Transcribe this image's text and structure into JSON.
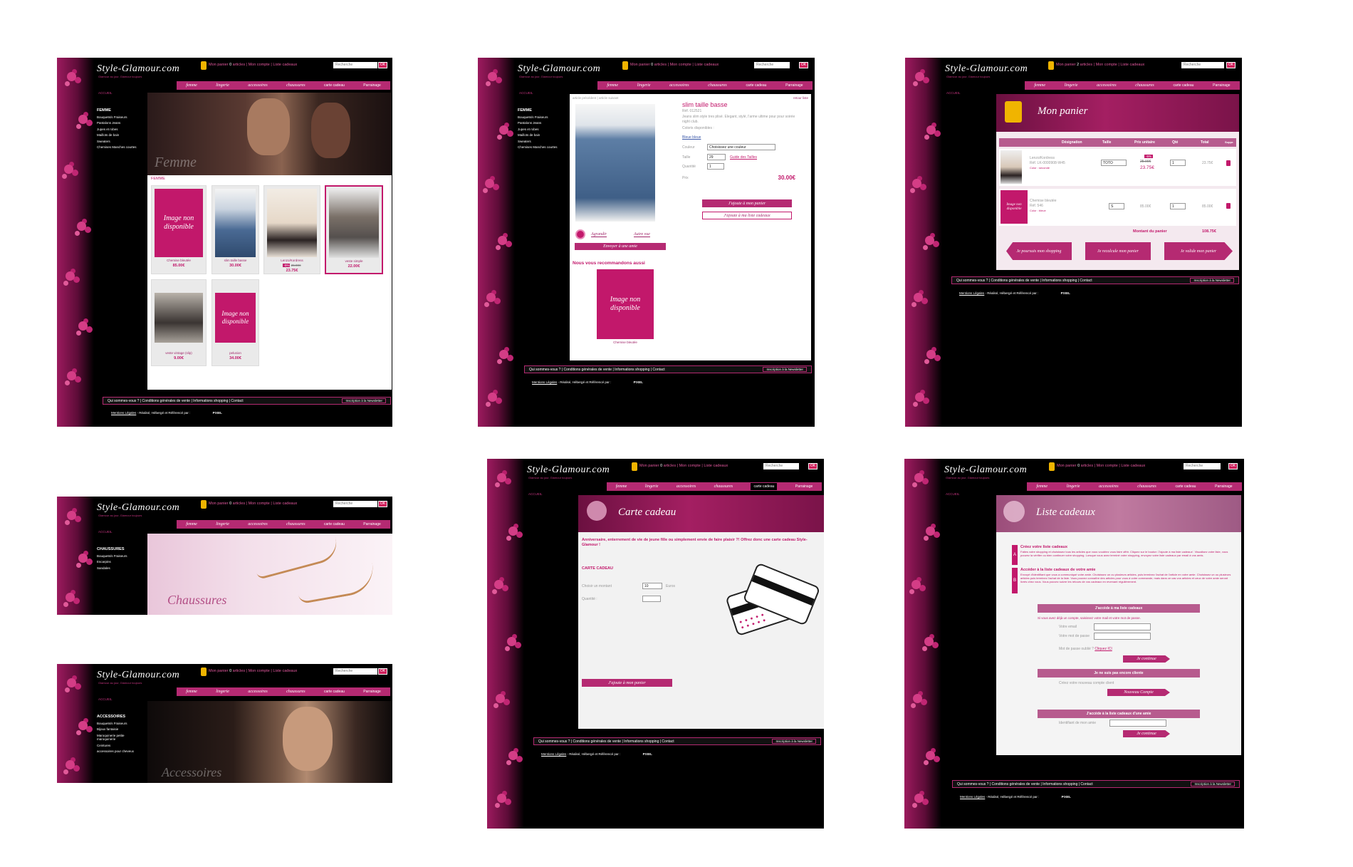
{
  "site": {
    "logo": "Style-Glamour.com",
    "slogan": "Glamour au jour, Glamour toujours",
    "cart_label": "Mon panier",
    "cart_suffix": "articles",
    "account": "Mon compte",
    "list": "Liste cadeaux",
    "search_placeholder": "Recherche",
    "ok": "OK",
    "nav": [
      "femme",
      "lingerie",
      "accessoires",
      "chaussures",
      "carte cadeau",
      "Parrainage"
    ],
    "accueil": "ACCUEIL",
    "footer_links": "Qui sommes-vous ?  |  Conditions générales de vente  |  Informations shopping  |  Contact",
    "newsletter": "Inscription à la Newsletter",
    "legal_link": "Mentions Légales",
    "legal_text": "- Réalisé, Hébergé et Référencé par :",
    "credit": "P!XEL",
    "cart_counts": [
      "0",
      "0",
      "2",
      "0",
      "0",
      "0"
    ]
  },
  "femme": {
    "sidebar_title": "FEMME",
    "sidebar_items": [
      "Bouquets/s Fraiseurs",
      "Pantalons Jeans",
      "Jupes et robes",
      "Maillots de bain",
      "Sweaters",
      "Chemises Manches courtes"
    ],
    "banner_text": "Femme",
    "section": "FEMME",
    "products": [
      {
        "name": "Chemise bleutée",
        "price": "85.00€",
        "noimg": "Image non disponible"
      },
      {
        "name": "slim taille basse",
        "price": "30.00€"
      },
      {
        "name": "Lenzo/Kordress",
        "price": "23.75€",
        "old_price": "25.00€",
        "badge": "-5%"
      },
      {
        "name": "veste simple",
        "price": "22.00€"
      },
      {
        "name": "veste vintage (slip)",
        "price": "9.00€"
      },
      {
        "name": "pelusion",
        "price": "34.00€",
        "noimg": "Image non disponible"
      }
    ]
  },
  "product": {
    "breadcrumb": "article précédent | article suivant",
    "back": "retour liste",
    "title": "slim taille basse",
    "ref": "Réf. 012521",
    "description": "Jeans slim style tres plisé. Elegant, stylé, l'arme ultime pour pour soirée night club.",
    "colors_label": "Coloris disponibles :",
    "color_link": "Bleue bleue",
    "couleur_label": "Couleur",
    "couleur_value": "Choisissez une couleur",
    "taille_label": "Taille",
    "taille_value": "29",
    "guide": "Guide des Tailles",
    "quantite_label": "Quantité",
    "quantite_value": "1",
    "prix_label": "Prix",
    "price": "30.00€",
    "add_cart": "J'ajoute à mon panier",
    "add_list": "J'ajoute à ma liste cadeaux",
    "agrandir": "Agrandir",
    "autre_vue": "Autre vue",
    "send_friend": "Envoyer à une amie",
    "reco_title": "Nous vous recommandons aussi",
    "reco_noimg": "Image non disponible",
    "reco_name": "Chemise bleutée"
  },
  "panier": {
    "title": "Mon panier",
    "headers": [
      "Désignation",
      "Taille",
      "Prix unitaire",
      "Qté",
      "Total",
      "Suppr."
    ],
    "rows": [
      {
        "name": "Lenzo/Kordress",
        "ref": "Réf. LK-0000908-W45",
        "color": "Color : seconde",
        "taille": "TOTO",
        "badge": "-5%",
        "old": "25.00€",
        "price": "23.75€",
        "qty": "1",
        "total": "23.75€"
      },
      {
        "name": "Chemise bleutée",
        "ref": "Réf. 546",
        "color": "Color : bleue",
        "taille": "S",
        "price": "85.00€",
        "qty": "1",
        "total": "85.00€",
        "noimg": "Image non disponible"
      }
    ],
    "total_label": "Montant du panier",
    "total": "108.75€",
    "btn_continue": "Je poursuis mon shopping",
    "btn_recalc": "Je recalcule mon panier",
    "btn_validate": "Je valide mon panier"
  },
  "chaussures": {
    "sidebar_title": "CHAUSSURES",
    "sidebar_items": [
      "Bouquets/s Fraiseurs",
      "Escarpins",
      "Sandales"
    ],
    "banner_text": "Chaussures"
  },
  "accessoires": {
    "sidebar_title": "ACCESSOIRES",
    "sidebar_items": [
      "Bouquets/s Fraiseurs",
      "Bijoux fantaisie",
      "Maroquinerie petite maroquinerie",
      "Ceintures",
      "accessoires pour cheveux"
    ],
    "banner_text": "Accessoires"
  },
  "carte": {
    "title": "Carte cadeau",
    "intro": "Anniversaire, enterrement de vie de jeune fille ou simplement envie de faire plaisir ?! Offrez donc une carte cadeau Style-Glamour !",
    "section": "CARTE CADEAU",
    "amount_label": "Choisir un montant",
    "amount_value": "10",
    "currency": "Euros",
    "qty_label": "Quantité :",
    "add_cart": "J'ajoute à mon panier"
  },
  "liste": {
    "title": "Liste cadeaux",
    "step_a_title": "Créez votre liste cadeaux",
    "step_a_text": "Faites votre shopping et choisissez tous les articles que vous voudriez vous faire offrir. Cliquez sur le bouton 'J'ajoute à ma liste cadeaux'. Visualisez votre liste, vous pouvez la vérifier ou bien continuer votre shopping. Lorsque vous avez terminé votre shopping, envoyez votre liste cadeaux par email à vos amis.",
    "step_b_title": "Accéder à la liste cadeaux de votre amie",
    "step_b_text": "Envoyé d'identifiant que vous a communiqué votre amie. Choisissez un ou plusieurs articles, puis terminez l'achat de l'article en votre amie. Choisissez un ou plusieurs articles puis terminez l'achat de la liste. Vous pouvez connaître des articles pour vous à votre commande, mais dans ce cas vos articles et ceux de votre amie seront livrés chez vous. Vous pouvez suivre les retours de vos cadeaux en revenant régulièrement.",
    "access_title": "J'accède à ma liste cadeaux",
    "access_hint": "Si vous avez déjà un compte, saisissez votre mail et votre mot de passe.",
    "email_label": "Votre email",
    "pwd_label": "Votre mot de passe",
    "forgot": "Mot de passe oublié ?",
    "forgot_link": "Cliquez ICI",
    "continue": "Je continue",
    "not_client": "Je ne suis pas encore cliente",
    "create": "Créez votre nouveau compte client",
    "new_account": "Nouveau Compte",
    "friend_title": "J'accède à la liste cadeaux d'une amie",
    "friend_label": "Identifiant de mon amie"
  }
}
